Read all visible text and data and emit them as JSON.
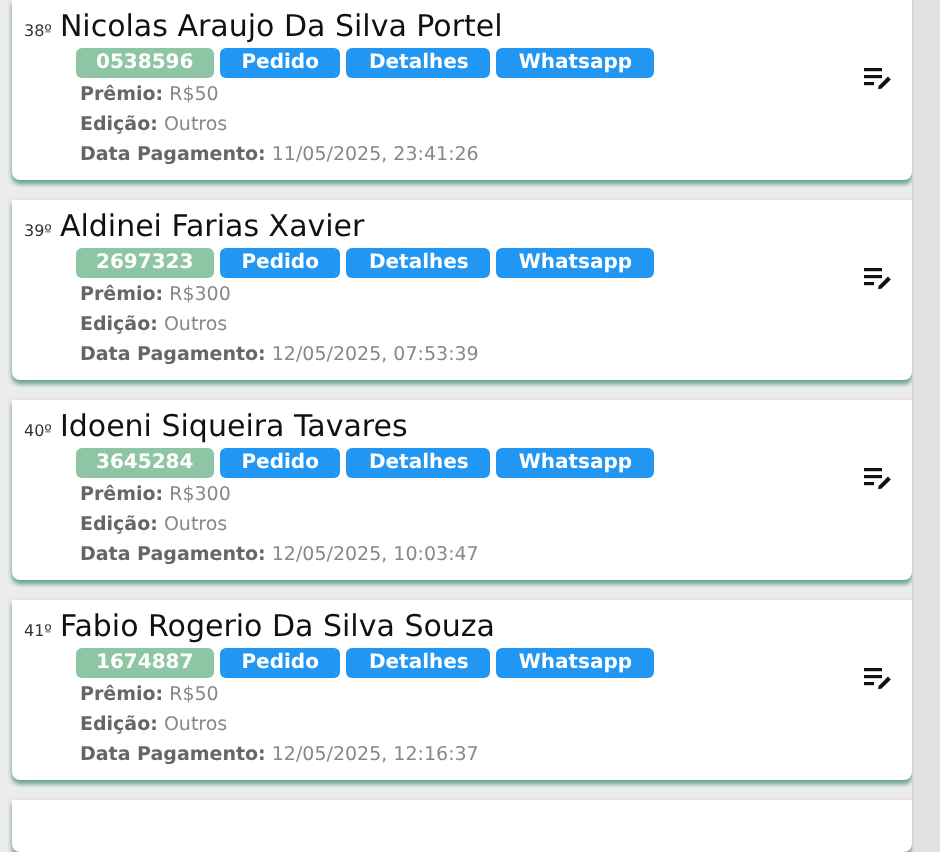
{
  "entries": [
    {
      "rank": "38º",
      "name": "Nicolas Araujo Da Silva Portel",
      "code": "0538596",
      "buttons": [
        "Pedido",
        "Detalhes",
        "Whatsapp"
      ],
      "fields": [
        {
          "label": "Prêmio:",
          "value": "R$50"
        },
        {
          "label": "Edição:",
          "value": "Outros"
        },
        {
          "label": "Data Pagamento:",
          "value": "11/05/2025, 23:41:26"
        }
      ]
    },
    {
      "rank": "39º",
      "name": "Aldinei Farias Xavier",
      "code": "2697323",
      "buttons": [
        "Pedido",
        "Detalhes",
        "Whatsapp"
      ],
      "fields": [
        {
          "label": "Prêmio:",
          "value": "R$300"
        },
        {
          "label": "Edição:",
          "value": "Outros"
        },
        {
          "label": "Data Pagamento:",
          "value": "12/05/2025, 07:53:39"
        }
      ]
    },
    {
      "rank": "40º",
      "name": "Idoeni Siqueira Tavares",
      "code": "3645284",
      "buttons": [
        "Pedido",
        "Detalhes",
        "Whatsapp"
      ],
      "fields": [
        {
          "label": "Prêmio:",
          "value": "R$300"
        },
        {
          "label": "Edição:",
          "value": "Outros"
        },
        {
          "label": "Data Pagamento:",
          "value": "12/05/2025, 10:03:47"
        }
      ]
    },
    {
      "rank": "41º",
      "name": "Fabio Rogerio Da Silva Souza",
      "code": "1674887",
      "buttons": [
        "Pedido",
        "Detalhes",
        "Whatsapp"
      ],
      "fields": [
        {
          "label": "Prêmio:",
          "value": "R$50"
        },
        {
          "label": "Edição:",
          "value": "Outros"
        },
        {
          "label": "Data Pagamento:",
          "value": "12/05/2025, 12:16:37"
        }
      ]
    }
  ]
}
